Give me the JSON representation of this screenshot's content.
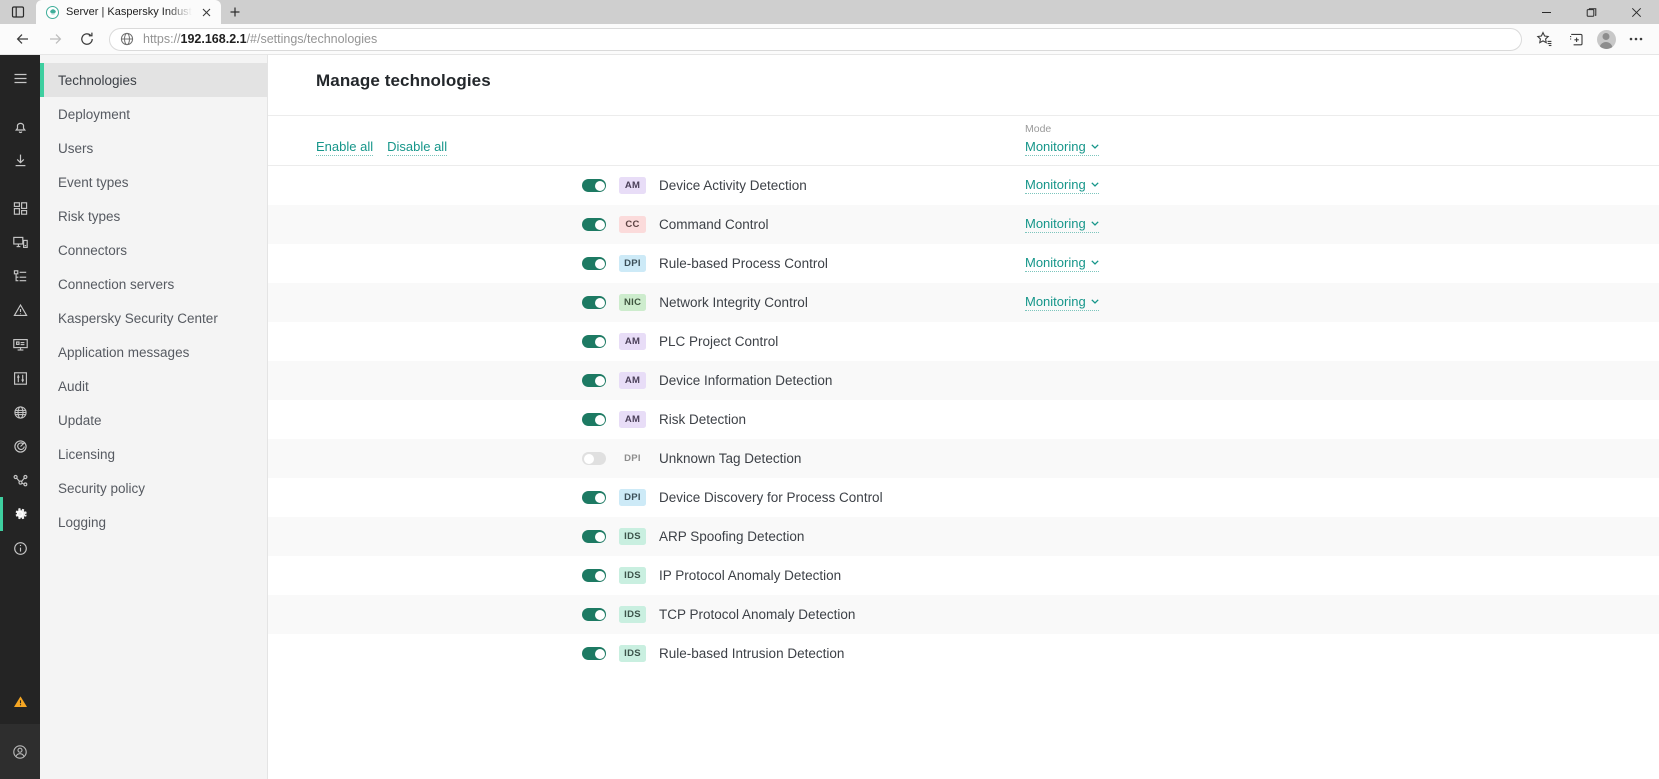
{
  "browser": {
    "tab": {
      "title": "Server | Kaspersky Industrial Cyb",
      "favicon_icon": "kaspersky-favicon",
      "close_icon": "close-icon"
    },
    "newtab_icon": "plus-icon",
    "tab_list_icon": "tab-actions-icon",
    "window_controls": {
      "minimize_icon": "minimize-icon",
      "maximize_icon": "maximize-icon",
      "close_icon": "window-close-icon"
    },
    "toolbar": {
      "back_icon": "back-arrow-icon",
      "forward_icon": "forward-arrow-icon",
      "reload_icon": "reload-icon",
      "site_info_icon": "globe-icon",
      "url_scheme": "https://",
      "url_host": "192.168.2.1",
      "url_path": "/#/settings/technologies",
      "favorites_icon": "favorites-star-icon",
      "collections_icon": "collections-icon",
      "profile_icon": "profile-avatar-icon",
      "settings_icon": "more-ellipsis-icon"
    }
  },
  "rail": {
    "items": [
      {
        "name": "menu",
        "icon": "hamburger-menu-icon",
        "active": false
      },
      {
        "name": "notifications",
        "icon": "bell-icon",
        "active": false
      },
      {
        "name": "downloads",
        "icon": "download-icon",
        "active": false
      },
      {
        "name": "dashboard",
        "icon": "dashboard-grid-icon",
        "active": false
      },
      {
        "name": "devices",
        "icon": "devices-icon",
        "active": false
      },
      {
        "name": "topology",
        "icon": "tree-list-icon",
        "active": false
      },
      {
        "name": "incidents",
        "icon": "warning-triangle-icon",
        "active": false
      },
      {
        "name": "monitoring",
        "icon": "monitor-icon",
        "active": false
      },
      {
        "name": "traffic",
        "icon": "traffic-sliders-icon",
        "active": false
      },
      {
        "name": "network-map",
        "icon": "globe-grid-icon",
        "active": false
      },
      {
        "name": "policies",
        "icon": "target-icon",
        "active": false
      },
      {
        "name": "connections",
        "icon": "nodes-graph-icon",
        "active": false
      },
      {
        "name": "settings",
        "icon": "gear-icon",
        "active": true
      },
      {
        "name": "about",
        "icon": "info-circle-icon",
        "active": false
      }
    ],
    "status_icon": "alert-triangle-warning-icon",
    "account_icon": "user-account-icon"
  },
  "nav": {
    "items": [
      {
        "label": "Technologies",
        "active": true
      },
      {
        "label": "Deployment",
        "active": false
      },
      {
        "label": "Users",
        "active": false
      },
      {
        "label": "Event types",
        "active": false
      },
      {
        "label": "Risk types",
        "active": false
      },
      {
        "label": "Connectors",
        "active": false
      },
      {
        "label": "Connection servers",
        "active": false
      },
      {
        "label": "Kaspersky Security Center",
        "active": false
      },
      {
        "label": "Application messages",
        "active": false
      },
      {
        "label": "Audit",
        "active": false
      },
      {
        "label": "Update",
        "active": false
      },
      {
        "label": "Licensing",
        "active": false
      },
      {
        "label": "Security policy",
        "active": false
      },
      {
        "label": "Logging",
        "active": false
      }
    ]
  },
  "main": {
    "title": "Manage technologies",
    "toolbar": {
      "enable_all_label": "Enable all",
      "disable_all_label": "Disable all",
      "mode_column_header": "Mode",
      "bulk_mode_value": "Monitoring",
      "caret_icon": "chevron-down-icon"
    },
    "technologies": [
      {
        "enabled": true,
        "badge": "AM",
        "badge_class": "am",
        "label": "Device Activity Detection",
        "mode": "Monitoring"
      },
      {
        "enabled": true,
        "badge": "CC",
        "badge_class": "cc",
        "label": "Command Control",
        "mode": "Monitoring"
      },
      {
        "enabled": true,
        "badge": "DPI",
        "badge_class": "dpi",
        "label": "Rule-based Process Control",
        "mode": "Monitoring"
      },
      {
        "enabled": true,
        "badge": "NIC",
        "badge_class": "nic",
        "label": "Network Integrity Control",
        "mode": "Monitoring"
      },
      {
        "enabled": true,
        "badge": "AM",
        "badge_class": "am",
        "label": "PLC Project Control",
        "mode": ""
      },
      {
        "enabled": true,
        "badge": "AM",
        "badge_class": "am",
        "label": "Device Information Detection",
        "mode": ""
      },
      {
        "enabled": true,
        "badge": "AM",
        "badge_class": "am",
        "label": "Risk Detection",
        "mode": ""
      },
      {
        "enabled": false,
        "badge": "DPI",
        "badge_class": "none",
        "label": "Unknown Tag Detection",
        "mode": ""
      },
      {
        "enabled": true,
        "badge": "DPI",
        "badge_class": "dpi",
        "label": "Device Discovery for Process Control",
        "mode": ""
      },
      {
        "enabled": true,
        "badge": "IDS",
        "badge_class": "ids",
        "label": "ARP Spoofing Detection",
        "mode": ""
      },
      {
        "enabled": true,
        "badge": "IDS",
        "badge_class": "ids",
        "label": "IP Protocol Anomaly Detection",
        "mode": ""
      },
      {
        "enabled": true,
        "badge": "IDS",
        "badge_class": "ids",
        "label": "TCP Protocol Anomaly Detection",
        "mode": ""
      },
      {
        "enabled": true,
        "badge": "IDS",
        "badge_class": "ids",
        "label": "Rule-based Intrusion Detection",
        "mode": ""
      }
    ]
  },
  "colors": {
    "accent_green": "#3ecfa0",
    "link_teal": "#16968a",
    "toggle_on": "#1d7a63",
    "rail_bg": "#242424",
    "nav_bg": "#f4f4f4",
    "warning_amber": "#f5a623"
  }
}
